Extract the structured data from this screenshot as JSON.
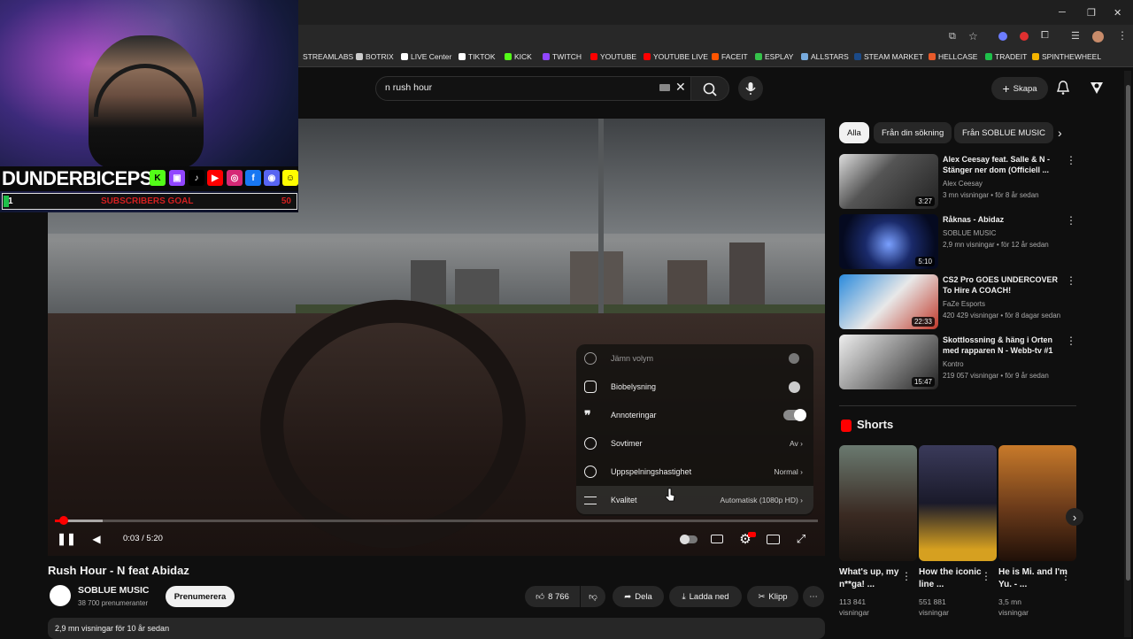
{
  "bookmarks": [
    "STREAMLABS",
    "BOTRIX",
    "LIVE Center",
    "TIKTOK",
    "KICK",
    "TWITCH",
    "YOUTUBE",
    "YOUTUBE LIVE",
    "FACEIT",
    "ESPLAY",
    "ALLSTARS",
    "STEAM MARKET",
    "HELLCASE",
    "TRADEIT",
    "SPINTHEWHEEL"
  ],
  "search": {
    "query": "n rush hour"
  },
  "header": {
    "create_label": "Skapa"
  },
  "webcam": {
    "streamer_name": "DUNDERBICEPS",
    "goal_label": "SUBSCRIBERS GOAL",
    "goal_current": "1",
    "goal_target": "50"
  },
  "settings_menu": {
    "items": [
      {
        "label": "Jämn volym",
        "type": "toggle",
        "state": "off"
      },
      {
        "label": "Biobelysning",
        "type": "toggle",
        "state": "off"
      },
      {
        "label": "Annoteringar",
        "type": "toggle",
        "state": "on"
      },
      {
        "label": "Sovtimer",
        "type": "value",
        "value": "Av"
      },
      {
        "label": "Uppspelningshastighet",
        "type": "value",
        "value": "Normal"
      },
      {
        "label": "Kvalitet",
        "type": "value",
        "value": "Automatisk (1080p HD)"
      }
    ]
  },
  "player": {
    "time": "0:03 / 5:20",
    "progress_fraction": 0.01
  },
  "video": {
    "title": "Rush Hour - N feat Abidaz",
    "channel": "SOBLUE MUSIC",
    "subscribers": "38 700 prenumeranter",
    "subscribe_label": "Prenumerera",
    "likes": "8 766",
    "share_label": "Dela",
    "download_label": "Ladda ned",
    "clip_label": "Klipp",
    "views_line": "2,9 mn visningar  för 10 år sedan"
  },
  "chips": [
    "Alla",
    "Från din sökning",
    "Från SOBLUE MUSIC"
  ],
  "recommendations": [
    {
      "title": "Alex Ceesay feat. Salle & N - Stänger ner dom (Officiell ...",
      "channel": "Alex Ceesay",
      "meta": "3 mn visningar • för 8 år sedan",
      "duration": "3:27"
    },
    {
      "title": "Råknas - Abidaz",
      "channel": "SOBLUE MUSIC",
      "meta": "2,9 mn visningar • för 12 år sedan",
      "duration": "5:10"
    },
    {
      "title": "CS2 Pro GOES UNDERCOVER To Hire A COACH!",
      "channel": "FaZe Esports",
      "meta": "420 429 visningar • för 8 dagar sedan",
      "duration": "22:33"
    },
    {
      "title": "Skottlossning & häng i Orten med rapparen N - Webb-tv #1",
      "channel": "Kontro",
      "meta": "219 057 visningar • för 9 år sedan",
      "duration": "15:47"
    }
  ],
  "shorts": {
    "title": "Shorts",
    "items": [
      {
        "title": "What's up, my n**ga! ...",
        "views": "113 841 visningar"
      },
      {
        "title": "How the iconic line ...",
        "views": "551 881 visningar"
      },
      {
        "title": "He is Mi. and I'm Yu. - ...",
        "views": "3,5 mn visningar"
      }
    ]
  }
}
